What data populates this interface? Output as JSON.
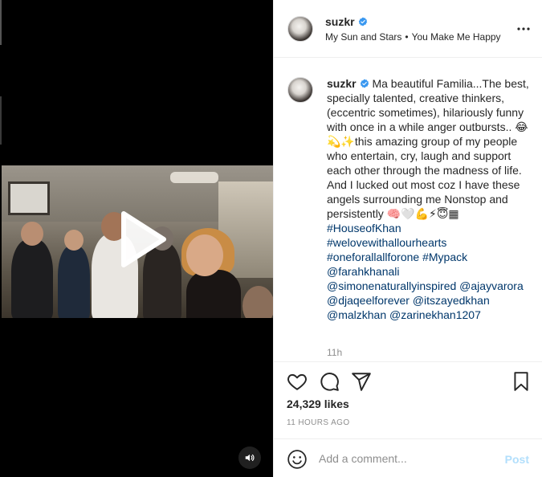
{
  "post": {
    "username": "suzkr",
    "verified": true,
    "audio_subtitle": {
      "song": "My Sun and Stars",
      "separator": "•",
      "title": "You Make Me Happy"
    },
    "caption": {
      "username": "suzkr",
      "text": "Ma beautiful Familia...The best, specially talented, creative thinkers, (eccentric sometimes), hilariously funny with once in a while anger outbursts.. 😂💫✨this amazing group of my people who entertain, cry, laugh and support each other through the madness of life. And I lucked out most coz I have these angels surrounding me Nonstop and persistently 🧠🤍💪⚡😇▦",
      "hashtags": [
        "#HouseofKhan",
        "#welovewithallourhearts",
        "#oneforallallforone #Mypack"
      ],
      "mentions": [
        "@farahkhanali",
        "@simonenaturallyinspired @ajayvarora",
        "@djaqeelforever @itszayedkhan",
        "@malzkhan @zarinekhan1207"
      ],
      "relative_time": "11h"
    },
    "likes": "24,329 likes",
    "timestamp": "11 HOURS AGO"
  },
  "comment_box": {
    "placeholder": "Add a comment...",
    "post_label": "Post"
  },
  "icons": {
    "play": "play-icon",
    "volume": "volume-icon",
    "verified": "verified-badge-icon",
    "more": "more-options-icon",
    "like": "heart-icon",
    "comment": "comment-bubble-icon",
    "share": "paper-plane-icon",
    "save": "bookmark-icon",
    "emoji": "smiley-icon"
  },
  "colors": {
    "verified_blue": "#3897f0",
    "link_blue": "#00376b",
    "post_button_disabled": "#b2dffc",
    "muted_text": "#8e8e8e"
  }
}
